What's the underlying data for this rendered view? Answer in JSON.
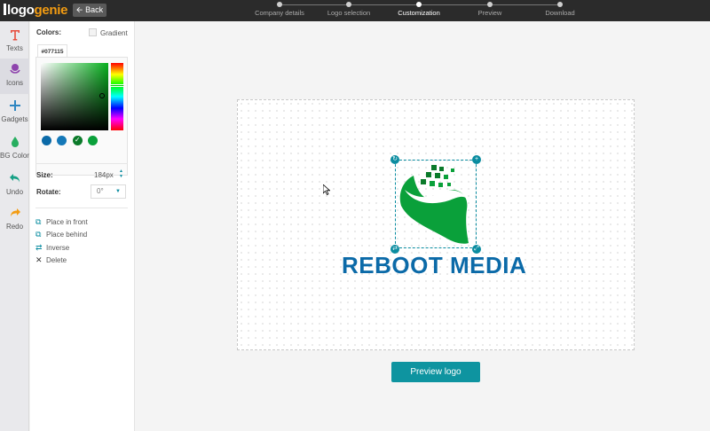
{
  "header": {
    "logo_part1": "logo",
    "logo_part2": "genie",
    "back_label": "Back",
    "steps": [
      {
        "label": "Company details"
      },
      {
        "label": "Logo selection"
      },
      {
        "label": "Customization"
      },
      {
        "label": "Preview"
      },
      {
        "label": "Download"
      }
    ],
    "active_step": "Customization"
  },
  "tools": [
    {
      "label": "Texts",
      "icon": "text-t-icon"
    },
    {
      "label": "Icons",
      "icon": "icons-icon"
    },
    {
      "label": "Gadgets",
      "icon": "plus-icon"
    },
    {
      "label": "BG Color",
      "icon": "drop-icon"
    },
    {
      "label": "Undo",
      "icon": "undo-icon"
    },
    {
      "label": "Redo",
      "icon": "redo-icon"
    }
  ],
  "panel": {
    "colors_label": "Colors:",
    "gradient_label": "Gradient",
    "hex_value": "#077115",
    "swatches": [
      "#0b6aa8",
      "#1478b8",
      "#0b7a2a",
      "#0aa03a"
    ],
    "size_label": "Size:",
    "size_value": "184px",
    "rotate_label": "Rotate:",
    "rotate_value": "0°",
    "actions": [
      {
        "label": "Place in front",
        "icon": "place-front-icon"
      },
      {
        "label": "Place behind",
        "icon": "place-behind-icon"
      },
      {
        "label": "Inverse",
        "icon": "inverse-icon"
      },
      {
        "label": "Delete",
        "icon": "delete-x-icon"
      }
    ]
  },
  "canvas": {
    "brand_text": "REBOOT MEDIA",
    "brand_color": "#0b6aa8",
    "icon_color": "#0aa03a"
  },
  "preview_label": "Preview logo",
  "accent_color": "#0e94a0"
}
